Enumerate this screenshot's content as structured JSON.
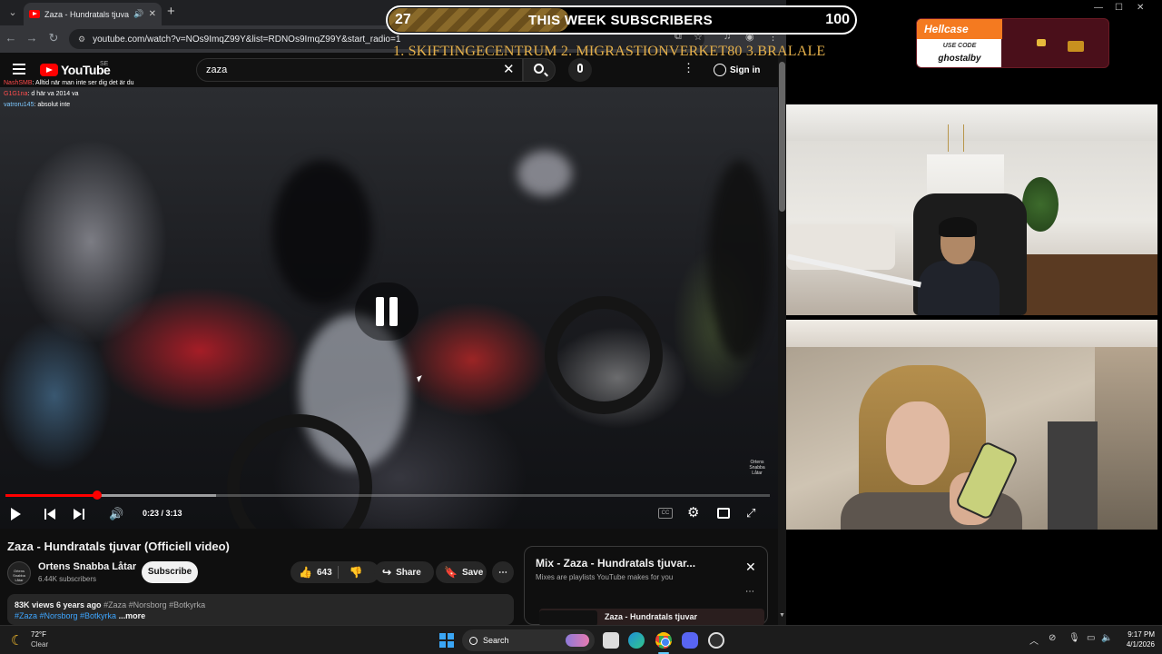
{
  "browser": {
    "tab_title": "Zaza - Hundratals tjuvar (O",
    "url": "youtube.com/watch?v=NOs9ImqZ99Y&list=RDNOs9ImqZ99Y&start_radio=1"
  },
  "youtube": {
    "logo_text": "YouTube",
    "country_code": "SE",
    "search_value": "zaza",
    "sign_in_label": "Sign in"
  },
  "chat": [
    {
      "user": "NashSMB",
      "message": ": Alltid när man inte ser dig det är du"
    },
    {
      "user": "G1G1na",
      "message": ": d här va 2014 va"
    },
    {
      "user": "vatroru145",
      "message": ": absolut inte"
    }
  ],
  "player": {
    "current_time": "0:23",
    "duration": "3:13",
    "time_display": "0:23 / 3:13",
    "progress_fraction": 0.12,
    "buffered_fraction": 0.275,
    "watermark": "Ortens Snabba Låtar",
    "cc_label": "CC"
  },
  "video": {
    "title": "Zaza - Hundratals tjuvar (Officiell video)",
    "channel_name": "Ortens Snabba Låtar",
    "channel_avatar_text": "Ortens Snabba Låtar",
    "subscribers": "6.44K subscribers",
    "subscribe_label": "Subscribe",
    "likes": "643",
    "share_label": "Share",
    "save_label": "Save",
    "views_and_age": "83K views  6 years ago",
    "header_tags": "#Zaza #Norsborg #Botkyrka",
    "desc_tags": "#Zaza #Norsborg #Botkyrka",
    "more_label": "...more"
  },
  "mix": {
    "title": "Mix - Zaza - Hundratals tjuvar...",
    "subtitle": "Mixes are playlists YouTube makes for you",
    "first_item": "Zaza - Hundratals tjuvar"
  },
  "overlay": {
    "sub_current": "27",
    "sub_label": "THIS WEEK SUBSCRIBERS",
    "sub_goal": "100",
    "sub_progress_fraction": 0.27,
    "top_list": "1. SKIFTINGECENTRUM  2. MIGRASTIONVERKET80  3.BRALALE",
    "sponsor_brand": "Hellcase",
    "sponsor_use_code": "USE CODE",
    "sponsor_code": "ghostalby"
  },
  "taskbar": {
    "temperature": "72°F",
    "condition": "Clear",
    "search_label": "Search",
    "time": "9:17 PM",
    "date": "4/1/2026"
  },
  "colors": {
    "youtube_red": "#ff0000",
    "overlay_gold": "#e5b04a",
    "hellcase_orange": "#f47a20"
  },
  "icons": [
    "hamburger-icon",
    "search-icon",
    "mic-icon",
    "more-icon",
    "user-icon",
    "play-icon",
    "prev-icon",
    "next-icon",
    "volume-icon",
    "settings-icon",
    "theater-icon",
    "fullscreen-icon",
    "like-icon",
    "dislike-icon",
    "share-icon",
    "save-icon",
    "close-icon",
    "windows-start-icon"
  ]
}
